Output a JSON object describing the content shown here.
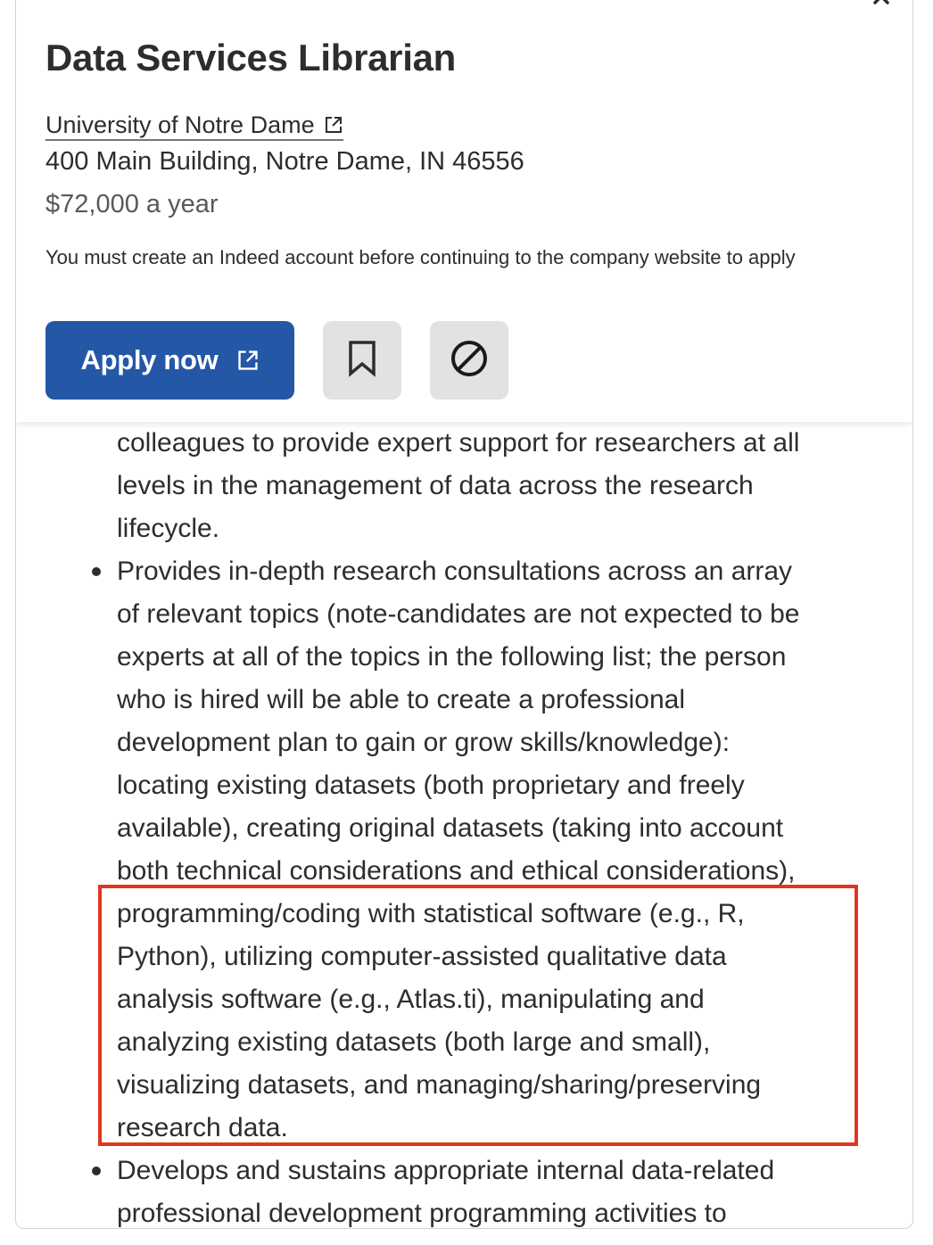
{
  "header": {
    "job_title": "Data Services Librarian",
    "company": "University of Notre Dame",
    "location": "400 Main Building, Notre Dame, IN 46556",
    "salary": "$72,000 a year",
    "notice": "You must create an Indeed account before continuing to the company website to apply",
    "apply_label": "Apply now"
  },
  "description": {
    "block1": [
      "colleagues to provide expert support for researchers at all",
      "levels in the management of data across the research",
      "lifecycle."
    ],
    "block2": [
      "Provides in-depth research consultations across an array",
      "of relevant topics (note-candidates are not expected to be",
      "experts at all of the topics in the following list; the person",
      "who is hired will be able to create a professional",
      "development plan to gain or grow skills/knowledge):",
      "locating existing datasets (both proprietary and freely",
      "available), creating original datasets (taking into account",
      "both technical considerations and ethical considerations),",
      "programming/coding with statistical software (e.g., R,",
      "Python), utilizing computer-assisted qualitative data",
      "analysis software (e.g., Atlas.ti), manipulating and",
      "analyzing existing datasets (both large and small),",
      "visualizing datasets, and managing/sharing/preserving",
      "research data."
    ],
    "block3": [
      "Develops and sustains appropriate internal data-related",
      "professional development programming activities to"
    ]
  },
  "colors": {
    "apply_button": "#2557a7",
    "icon_button": "#e4e2e0",
    "highlight_box": "#e0381e",
    "text": "#2d2d2d"
  },
  "icons": {
    "close": "close-icon",
    "external_link": "external-link-icon",
    "bookmark": "bookmark-icon",
    "not_interested": "block-icon"
  }
}
